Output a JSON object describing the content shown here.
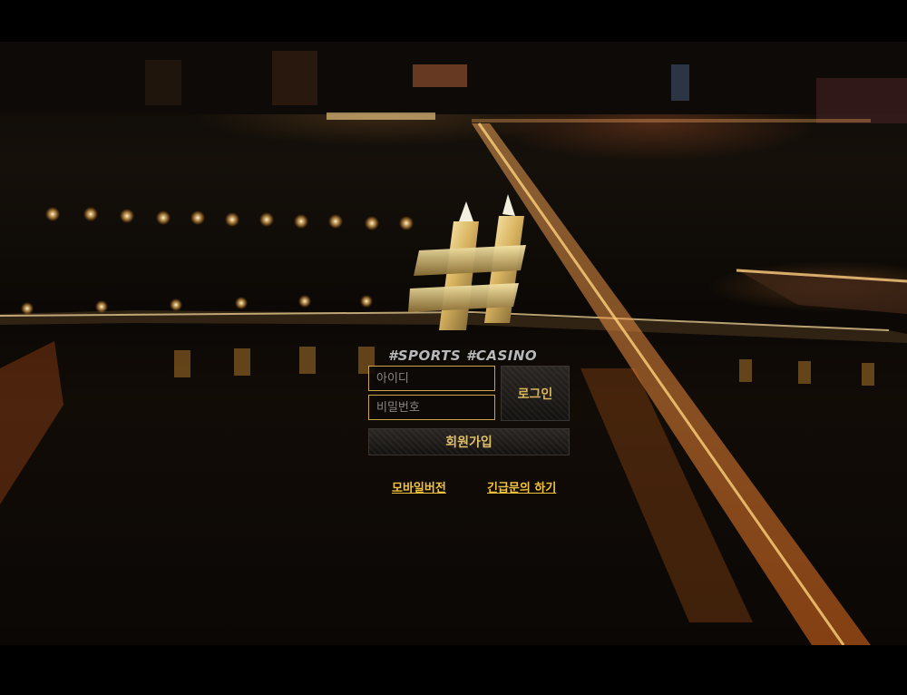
{
  "brand": {
    "tagline": "#SPORTS #CASINO",
    "accent_color": "#c9a44a"
  },
  "login": {
    "id_placeholder": "아이디",
    "password_placeholder": "비밀번호",
    "login_label": "로그인",
    "join_label": "회원가입"
  },
  "links": {
    "mobile": "모바일버전",
    "inquiry": "긴급문의 하기",
    "link_color": "#f2c23a"
  },
  "icons": {
    "logo": "hash-logo-icon"
  }
}
